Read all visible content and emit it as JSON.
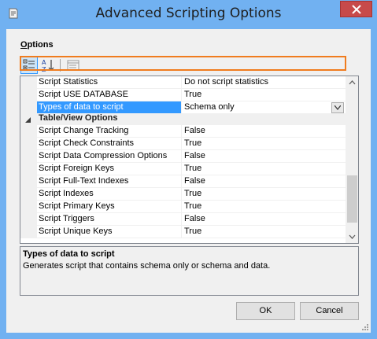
{
  "window": {
    "title": "Advanced Scripting Options"
  },
  "options_label": {
    "accel": "O",
    "rest": "ptions"
  },
  "toolbar": {
    "categorized_icon": "categorized-icon",
    "alphabetical_icon": "alphabetical-sort-icon",
    "property_pages_icon": "property-pages-icon"
  },
  "grid": {
    "rows_top": [
      {
        "name": "Script Statistics",
        "value": "Do not script statistics"
      },
      {
        "name": "Script USE DATABASE",
        "value": "True"
      },
      {
        "name": "Types of data to script",
        "value": "Schema only"
      }
    ],
    "category": "Table/View Options",
    "rows": [
      {
        "name": "Script Change Tracking",
        "value": "False"
      },
      {
        "name": "Script Check Constraints",
        "value": "True"
      },
      {
        "name": "Script Data Compression Options",
        "value": "False"
      },
      {
        "name": "Script Foreign Keys",
        "value": "True"
      },
      {
        "name": "Script Full-Text Indexes",
        "value": "False"
      },
      {
        "name": "Script Indexes",
        "value": "True"
      },
      {
        "name": "Script Primary Keys",
        "value": "True"
      },
      {
        "name": "Script Triggers",
        "value": "False"
      },
      {
        "name": "Script Unique Keys",
        "value": "True"
      }
    ]
  },
  "description": {
    "title": "Types of data to script",
    "text": "Generates script that contains schema only or schema and data."
  },
  "buttons": {
    "ok": "OK",
    "cancel": "Cancel"
  },
  "colors": {
    "titlebar": "#71b1f1",
    "selection": "#3399ff",
    "highlight": "#f07c1e",
    "close": "#c74a4a"
  }
}
